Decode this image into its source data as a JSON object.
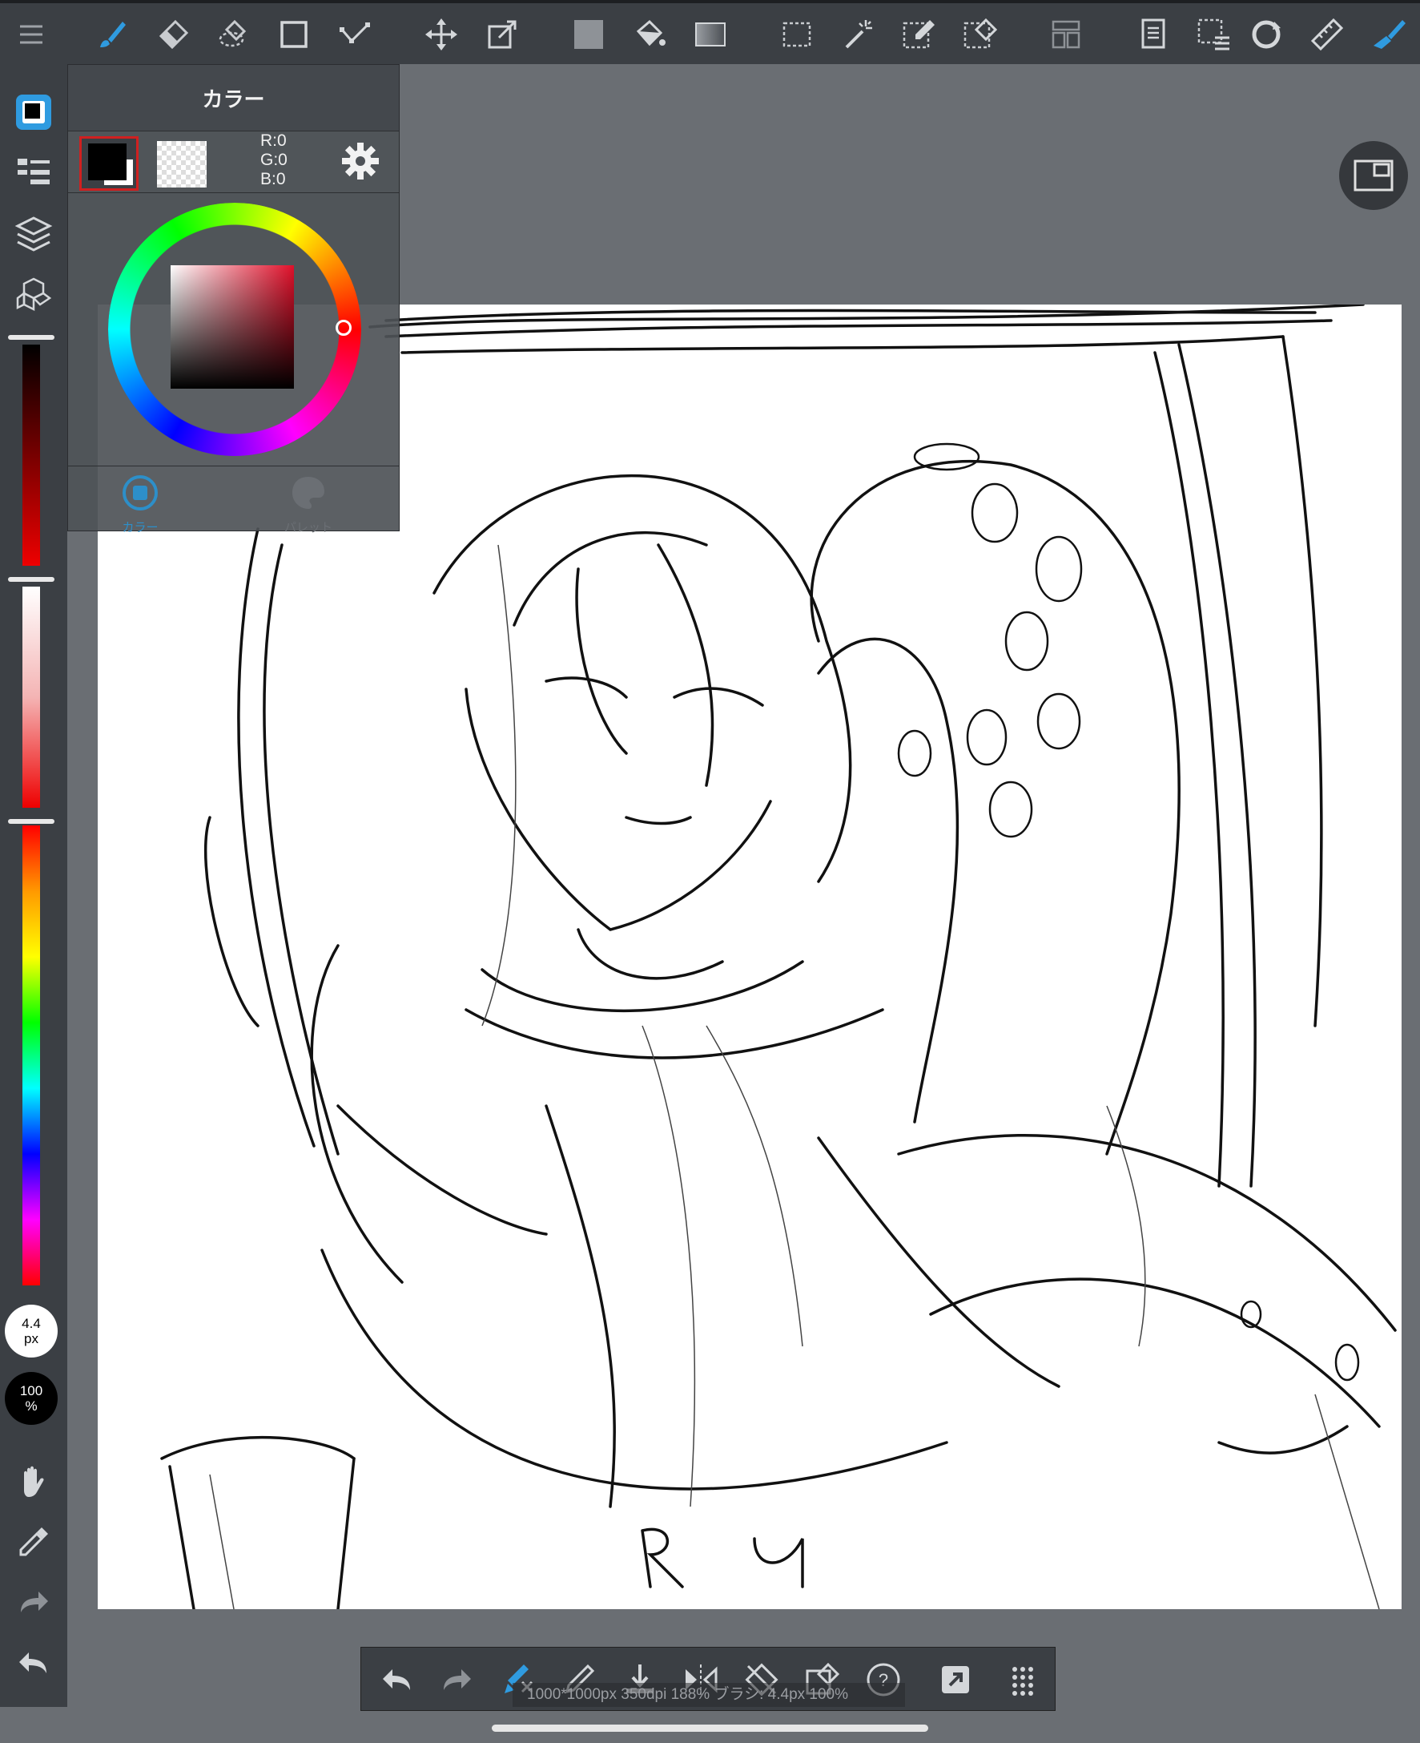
{
  "toolbar": {
    "tools": [
      {
        "id": "menu",
        "icon": "hamburger-icon"
      },
      {
        "id": "brush",
        "icon": "brush-icon",
        "active": true
      },
      {
        "id": "eraser",
        "icon": "eraser-icon"
      },
      {
        "id": "lasso-eraser",
        "icon": "lasso-eraser-icon"
      },
      {
        "id": "shape",
        "icon": "square-shape-icon"
      },
      {
        "id": "pen-path",
        "icon": "path-pen-icon"
      },
      {
        "id": "move",
        "icon": "move-icon"
      },
      {
        "id": "transform",
        "icon": "transform-icon"
      },
      {
        "id": "fill-color",
        "icon": "fill-color-swatch-icon"
      },
      {
        "id": "bucket",
        "icon": "paint-bucket-icon"
      },
      {
        "id": "gradient",
        "icon": "gradient-icon"
      },
      {
        "id": "select-rect",
        "icon": "rect-select-icon"
      },
      {
        "id": "magic-wand",
        "icon": "magic-wand-icon"
      },
      {
        "id": "select-pen",
        "icon": "select-pen-icon"
      },
      {
        "id": "select-eraser",
        "icon": "select-eraser-icon"
      },
      {
        "id": "panel-layout",
        "icon": "panel-layout-icon"
      },
      {
        "id": "text",
        "icon": "text-icon"
      },
      {
        "id": "selection-menu",
        "icon": "selection-menu-icon"
      },
      {
        "id": "rotate",
        "icon": "rotate-icon"
      },
      {
        "id": "ruler",
        "icon": "ruler-icon"
      },
      {
        "id": "snap-pen",
        "icon": "snap-pen-icon",
        "active": true
      }
    ]
  },
  "sidebar": {
    "buttons": [
      "color-swatch-icon",
      "brush-list-icon",
      "layers-icon",
      "materials-icon"
    ],
    "brush_size": {
      "value": "4.4",
      "unit": "px"
    },
    "opacity": {
      "value": "100",
      "unit": "%"
    },
    "bottom_tools": [
      "hand-icon",
      "eyedropper-icon",
      "redo-icon",
      "undo-icon"
    ],
    "slider_levels": {
      "value_bar": 0.0,
      "saturation_bar": 0.0,
      "hue_bar": 0.0
    }
  },
  "color_panel": {
    "title": "カラー",
    "rgb": {
      "r": "R:0",
      "g": "G:0",
      "b": "B:0"
    },
    "main_color": "#000000",
    "sub_color": "#ffffff",
    "hue_color": "#e0102a",
    "tabs": [
      {
        "label": "カラー",
        "icon": "color-tab-icon",
        "active": true
      },
      {
        "label": "パレット",
        "icon": "palette-tab-icon",
        "active": false
      }
    ]
  },
  "status": {
    "text": "1000*1000px 350dpi 188% ブラシ: 4.4px 100%"
  },
  "bottom_bar": {
    "buttons": [
      "undo-icon",
      "redo-icon",
      "brush-settings-icon",
      "pen-icon",
      "import-icon",
      "flip-icon",
      "rotate-reset-icon",
      "clear-icon",
      "help-icon",
      "export-icon",
      "grid-dots-icon"
    ]
  },
  "canvas": {
    "signature_text": "R U I"
  }
}
